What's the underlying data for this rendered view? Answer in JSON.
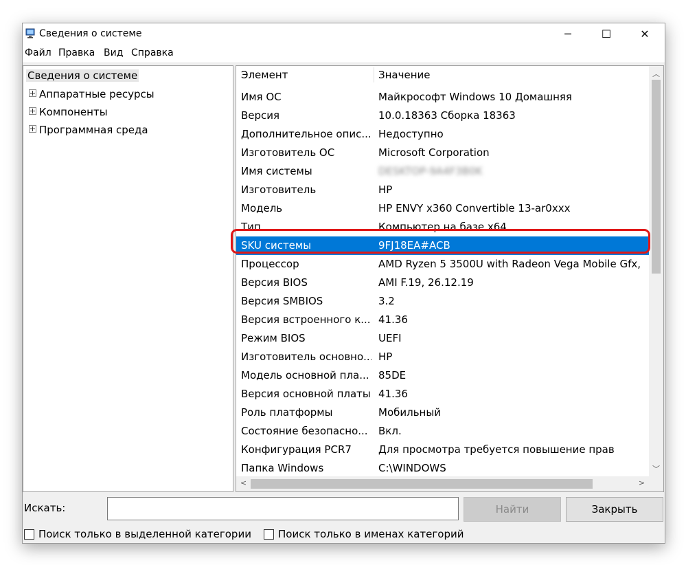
{
  "window": {
    "title": "Сведения о системе",
    "controls": {
      "minimize": "─",
      "maximize": "☐",
      "close": "✕"
    }
  },
  "menu": [
    "Файл",
    "Правка",
    "Вид",
    "Справка"
  ],
  "tree": {
    "root": "Сведения о системе",
    "children": [
      "Аппаратные ресурсы",
      "Компоненты",
      "Программная среда"
    ]
  },
  "table": {
    "headers": [
      "Элемент",
      "Значение"
    ],
    "rows": [
      [
        "Имя ОС",
        "Майкрософт Windows 10 Домашняя"
      ],
      [
        "Версия",
        "10.0.18363 Сборка 18363"
      ],
      [
        "Дополнительное опис...",
        "Недоступно"
      ],
      [
        "Изготовитель ОС",
        "Microsoft Corporation"
      ],
      [
        "Имя системы",
        "DESKTOP-9A4F3B0K"
      ],
      [
        "Изготовитель",
        "HP"
      ],
      [
        "Модель",
        "HP ENVY x360 Convertible 13-ar0xxx"
      ],
      [
        "Тип",
        "Компьютер на базе x64"
      ],
      [
        "SKU системы",
        "9FJ18EA#ACB"
      ],
      [
        "Процессор",
        "AMD Ryzen 5 3500U with Radeon Vega Mobile Gfx,"
      ],
      [
        "Версия BIOS",
        "AMI F.19, 26.12.19"
      ],
      [
        "Версия SMBIOS",
        "3.2"
      ],
      [
        "Версия встроенного к...",
        "41.36"
      ],
      [
        "Режим BIOS",
        "UEFI"
      ],
      [
        "Изготовитель основно...",
        "HP"
      ],
      [
        "Модель основной пла...",
        "85DE"
      ],
      [
        "Версия основной платы",
        "41.36"
      ],
      [
        "Роль платформы",
        "Мобильный"
      ],
      [
        "Состояние безопасно...",
        "Вкл."
      ],
      [
        "Конфигурация PCR7",
        "Для просмотра требуется повышение прав"
      ],
      [
        "Папка Windows",
        "C:\\WINDOWS"
      ]
    ],
    "selected_row": 8,
    "blurred_row": 4
  },
  "search": {
    "label": "Искать:",
    "value": ""
  },
  "buttons": {
    "find": "Найти",
    "close": "Закрыть"
  },
  "checkboxes": [
    {
      "label": "Поиск только в выделенной категории",
      "checked": false
    },
    {
      "label": "Поиск только в именах категорий",
      "checked": false
    }
  ],
  "colors": {
    "selection": "#0078d7",
    "highlight_ring": "#e01818"
  },
  "icons": [
    "system-info-icon",
    "tree-expand-icon",
    "scroll-up-icon",
    "scroll-down-icon",
    "scroll-left-icon",
    "scroll-right-icon"
  ]
}
